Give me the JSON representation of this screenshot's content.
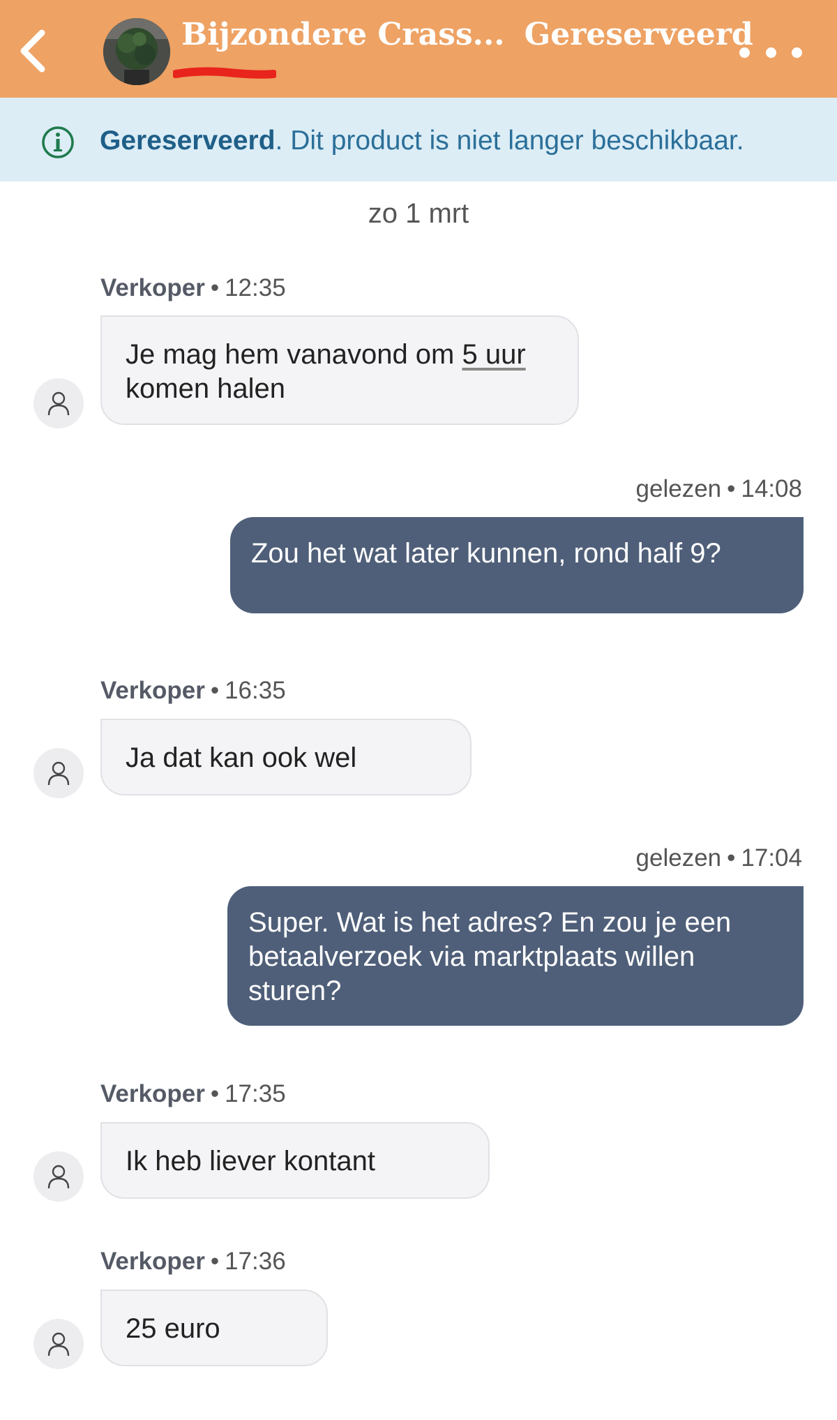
{
  "header": {
    "back_icon": "chevron-left-icon",
    "title": "Bijzondere Crass...",
    "status": "Gereserveerd",
    "more_icon": "more-dots-icon",
    "bg_color": "#eea264"
  },
  "banner": {
    "icon": "info-icon",
    "strong": "Gereserveerd",
    "text": ". Dit product is niet langer beschikbaar.",
    "bg_color": "#dcedf6"
  },
  "date": "zo 1 mrt",
  "messages": [
    {
      "side": "in",
      "author": "Verkoper",
      "time": "12:35",
      "line1_a": "Je mag hem vanavond  om ",
      "line1_link": "5 uur",
      "line2": "komen halen"
    },
    {
      "side": "out",
      "status": "gelezen",
      "time": "14:08",
      "text": "Zou het wat later kunnen, rond half 9?"
    },
    {
      "side": "in",
      "author": "Verkoper",
      "time": "16:35",
      "text": "Ja dat kan ook wel"
    },
    {
      "side": "out",
      "status": "gelezen",
      "time": "17:04",
      "line1": "Super. Wat is het adres? En zou je een",
      "line2": "betaalverzoek via marktplaats willen",
      "line3": "sturen?"
    },
    {
      "side": "in",
      "author": "Verkoper",
      "time": "17:35",
      "text": "Ik heb liever kontant"
    },
    {
      "side": "in",
      "author": "Verkoper",
      "time": "17:36",
      "text": "25 euro"
    }
  ],
  "dot": "•",
  "colors": {
    "outgoing_bubble": "#4f5f79",
    "incoming_bubble": "#f4f4f6"
  }
}
